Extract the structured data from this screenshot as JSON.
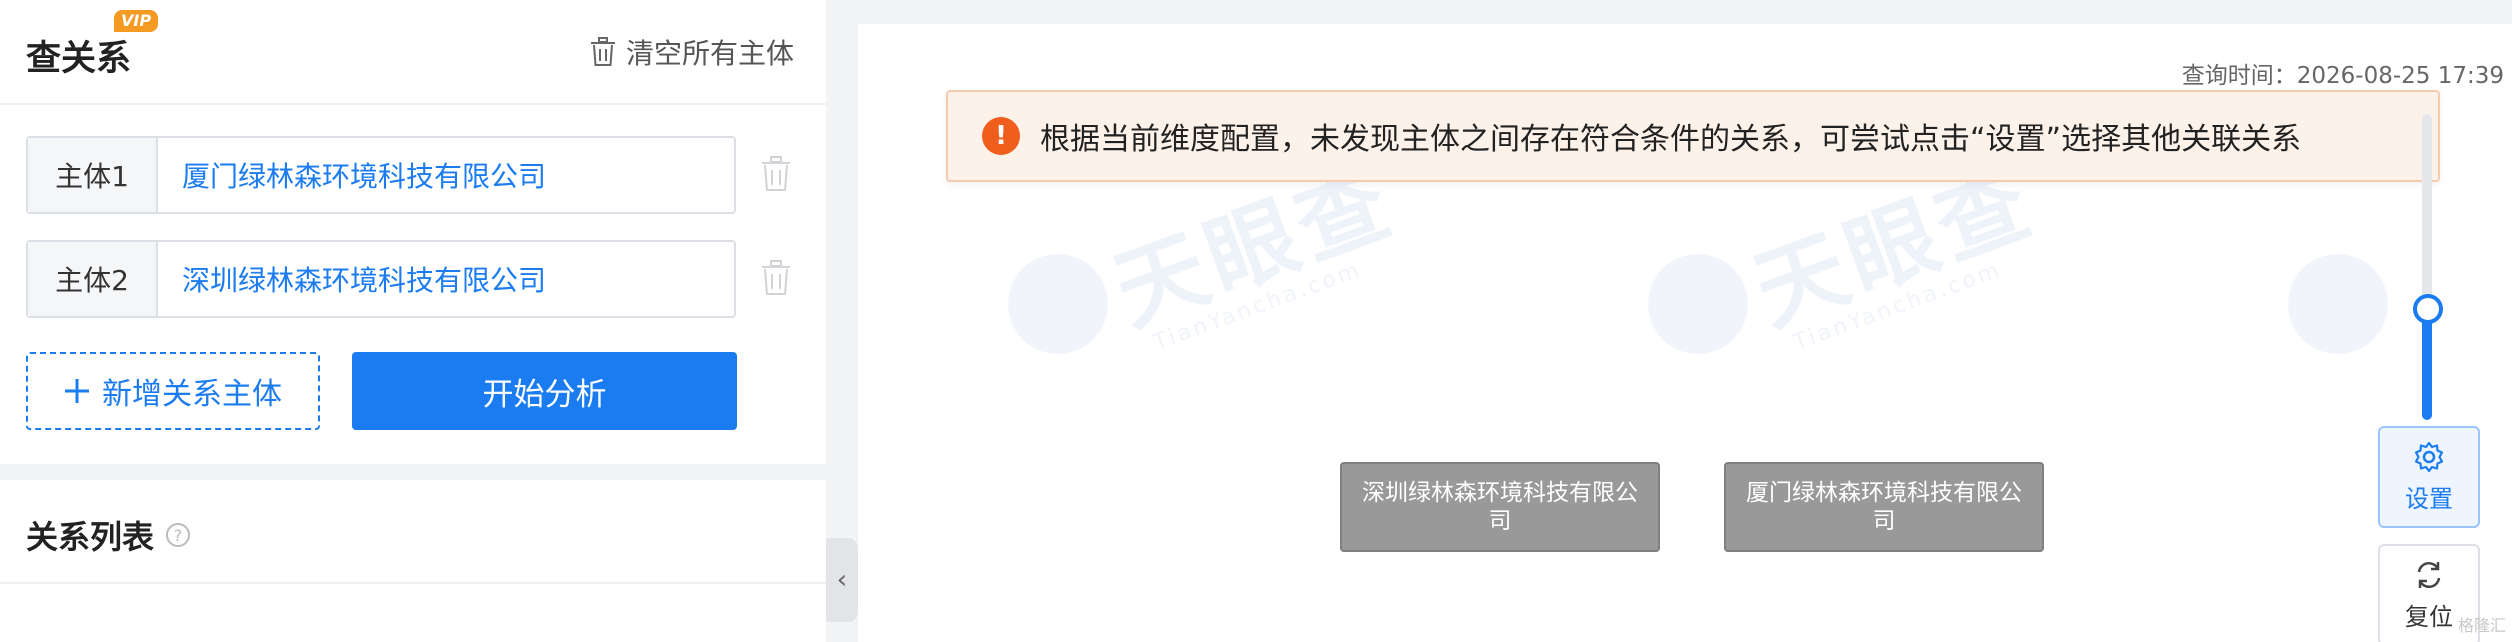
{
  "left": {
    "title": "查关系",
    "vip_badge": "VIP",
    "clear_all": "清空所有主体",
    "entities": [
      {
        "label": "主体1",
        "value": "厦门绿林森环境科技有限公司"
      },
      {
        "label": "主体2",
        "value": "深圳绿林森环境科技有限公司"
      }
    ],
    "add_button": "新增关系主体",
    "start_button": "开始分析",
    "list_title": "关系列表",
    "help_glyph": "?"
  },
  "collapse_glyph": "‹",
  "canvas": {
    "query_time": "查询时间：2026-08-25 17:39",
    "alert_icon_glyph": "!",
    "alert_text": "根据当前维度配置，未发现主体之间存在符合条件的关系，可尝试点击“设置”选择其他关联关系",
    "nodes": [
      {
        "label": "深圳绿林森环境科技有限公司"
      },
      {
        "label": "厦门绿林森环境科技有限公司"
      }
    ],
    "zoom_level": 0.4,
    "settings_label": "设置",
    "reset_label": "复位",
    "watermark": "天眼查",
    "watermark_sub": "TianYancha.com",
    "corner_mark": "格隆汇"
  },
  "colors": {
    "accent": "#1a7cf0",
    "alert_icon": "#ef5e1c",
    "alert_bg": "#fdf2ea",
    "node_bg": "#999999",
    "vip": "#f59a23"
  }
}
